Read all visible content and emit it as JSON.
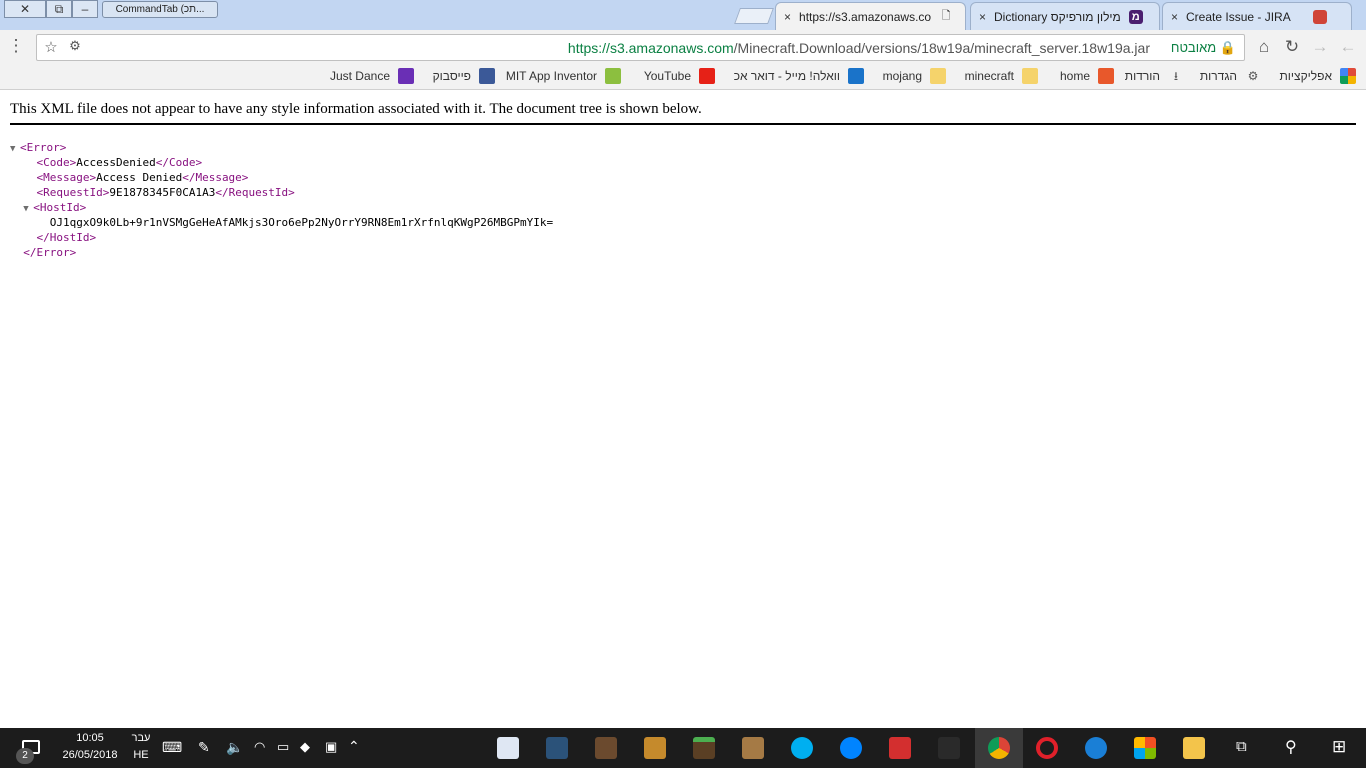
{
  "taskbar_window": {
    "task_label": "CommandTab (תכ..."
  },
  "tabs": [
    {
      "title": "https://s3.amazonaws.co",
      "close": "×",
      "favicon": "document-icon"
    },
    {
      "title": "Dictionary מילון מורפיקס",
      "close": "×",
      "favicon": "morfix-icon"
    },
    {
      "title": "Create Issue - JIRA",
      "close": "×",
      "favicon": "jira-icon"
    }
  ],
  "toolbar": {
    "url_scheme": "https://",
    "url_host": "s3.amazonaws.com",
    "url_path": "/Minecraft.Download/versions/18w19a/minecraft_server.18w19a.jar",
    "secure_label": "מאובטח"
  },
  "bookmarks": [
    {
      "label": "אפליקציות",
      "icon": "apps-grid-icon",
      "color": "#e04b3a"
    },
    {
      "label": "הגדרות",
      "icon": "gear-icon",
      "color": "#555555"
    },
    {
      "label": "הורדות",
      "icon": "download-icon",
      "color": "#555555"
    },
    {
      "label": "home",
      "icon": "home-bookmark-icon",
      "color": "#e8582b"
    },
    {
      "label": "minecraft",
      "icon": "folder-icon",
      "color": "#f5d36b"
    },
    {
      "label": "mojang",
      "icon": "folder-icon",
      "color": "#f5d36b"
    },
    {
      "label": "וואלה! מייל - דואר אכ",
      "icon": "walla-icon",
      "color": "#1a73c9"
    },
    {
      "label": "YouTube",
      "icon": "youtube-icon",
      "color": "#e62117"
    },
    {
      "label": "MIT App Inventor",
      "icon": "app-inventor-icon",
      "color": "#8cbf3f"
    },
    {
      "label": "פייסבוק",
      "icon": "facebook-icon",
      "color": "#3b5998"
    },
    {
      "label": "Just Dance",
      "icon": "just-dance-icon",
      "color": "#6a2fb5"
    }
  ],
  "page": {
    "notice": "This XML file does not appear to have any style information associated with it. The document tree is shown below.",
    "xml": {
      "root_open": "<Error>",
      "code_open": "<Code>",
      "code_value": "AccessDenied",
      "code_close": "</Code>",
      "message_open": "<Message>",
      "message_value": "Access Denied",
      "message_close": "</Message>",
      "requestid_open": "<RequestId>",
      "requestid_value": "9E1878345F0CA1A3",
      "requestid_close": "</RequestId>",
      "hostid_open": "<HostId>",
      "hostid_value": "OJ1qgxO9k0Lb+9r1nVSMgGeHeAfAMkjs3Oro6ePp2NyOrrY9RN8Em1rXrfnlqKWgP26MBGPmYIk=",
      "hostid_close": "</HostId>",
      "root_close": "</Error>"
    }
  },
  "taskbar": {
    "time": "10:05",
    "date": "26/05/2018",
    "lang_top": "עבר",
    "lang_bottom": "HE",
    "notifications": "2"
  },
  "colors": {
    "tag": "#881280",
    "secure": "#0b8043",
    "taskbar": "#1c1c1c"
  }
}
